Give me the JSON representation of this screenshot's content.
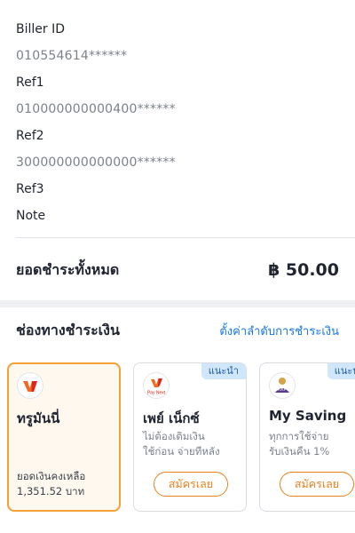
{
  "bill_details": {
    "biller_id_label": "Biller ID",
    "biller_id_value": "010554614******",
    "ref1_label": "Ref1",
    "ref1_value": "010000000000400******",
    "ref2_label": "Ref2",
    "ref2_value": "300000000000000******",
    "ref3_label": "Ref3",
    "note_label": "Note"
  },
  "total": {
    "label": "ยอดชำระทั้งหมด",
    "amount": "฿ 50.00"
  },
  "payment_channels": {
    "title": "ช่องทางชำระเงิน",
    "settings_link": "ตั้งค่าลำดับการชำระเงิน",
    "cards": [
      {
        "name": "ทรูมันนี่",
        "logo": "truemoney-logo",
        "selected": true,
        "balance_label": "ยอดเงินคงเหลือ",
        "balance_value": "1,351.52 บาท"
      },
      {
        "name": "เพย์ เน็กซ์",
        "logo": "pay-next-logo",
        "logo_text": "Pay Next",
        "badge": "แนะนำ",
        "desc_line1": "ไม่ต้องเติมเงิน",
        "desc_line2": "ใช้ก่อน จ่ายทีหลัง",
        "button": "สมัครเลย"
      },
      {
        "name": "My Saving",
        "logo": "kkp-logo",
        "logo_text": "KKP",
        "badge": "แนะนำ",
        "desc_line1": "ทุกการใช้จ่าย",
        "desc_line2": "รับเงินคืน 1%",
        "button": "สมัครเลย"
      }
    ]
  },
  "colors": {
    "accent_orange": "#f5a034",
    "link_blue": "#1677e8",
    "badge_bg": "#cfe6fb"
  }
}
